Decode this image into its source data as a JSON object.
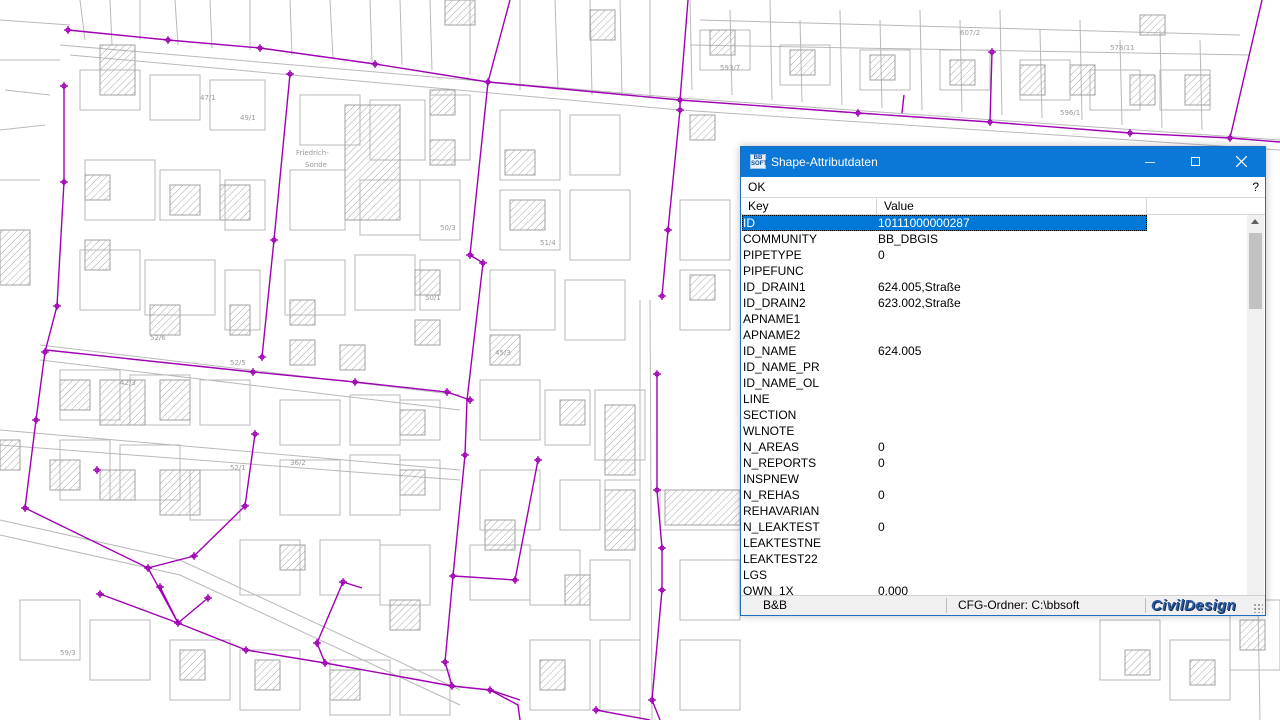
{
  "dialog": {
    "title": "Shape-Attributdaten",
    "app_icon": "bbsoft-app-icon",
    "menu": {
      "ok": "OK",
      "help": "?"
    },
    "columns": {
      "key": "Key",
      "value": "Value"
    },
    "rows": [
      {
        "key": "ID",
        "value": "10111000000287",
        "selected": true
      },
      {
        "key": "COMMUNITY",
        "value": "BB_DBGIS"
      },
      {
        "key": "PIPETYPE",
        "value": "0"
      },
      {
        "key": "PIPEFUNC",
        "value": ""
      },
      {
        "key": "ID_DRAIN1",
        "value": "624.005,Straße"
      },
      {
        "key": "ID_DRAIN2",
        "value": "623.002,Straße"
      },
      {
        "key": "APNAME1",
        "value": ""
      },
      {
        "key": "APNAME2",
        "value": ""
      },
      {
        "key": "ID_NAME",
        "value": "624.005"
      },
      {
        "key": "ID_NAME_PR",
        "value": ""
      },
      {
        "key": "ID_NAME_OL",
        "value": ""
      },
      {
        "key": "LINE",
        "value": ""
      },
      {
        "key": "SECTION",
        "value": ""
      },
      {
        "key": "WLNOTE",
        "value": ""
      },
      {
        "key": "N_AREAS",
        "value": "0"
      },
      {
        "key": "N_REPORTS",
        "value": "0"
      },
      {
        "key": "INSPNEW",
        "value": ""
      },
      {
        "key": "N_REHAS",
        "value": "0"
      },
      {
        "key": "REHAVARIAN",
        "value": ""
      },
      {
        "key": "N_LEAKTEST",
        "value": "0"
      },
      {
        "key": "LEAKTESTNE",
        "value": ""
      },
      {
        "key": "LEAKTEST22",
        "value": ""
      },
      {
        "key": "LGS",
        "value": ""
      },
      {
        "key": "OWN_1X",
        "value": "0.000"
      }
    ],
    "status": {
      "company": "B&B",
      "cfg": "CFG-Ordner:   C:\\bbsoft",
      "logo": "CivilDesign"
    }
  },
  "map": {
    "pipe_color": "#a000b4",
    "parcel_color": "#b8b8b8",
    "labels": [
      "Friedrich-Sonde",
      "52/6",
      "52/5",
      "47/1",
      "49/1",
      "50/3",
      "51/4",
      "50/1",
      "45/3",
      "42/3",
      "36/2",
      "52/1",
      "59/3",
      "593/7",
      "578/11",
      "607/2",
      "596/1"
    ]
  },
  "colors": {
    "titlebar": "#0b78d7",
    "selection": "#0078d7"
  }
}
